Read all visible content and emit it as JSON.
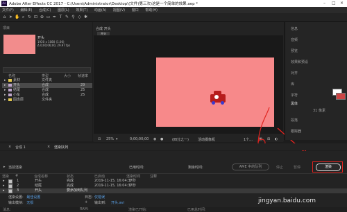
{
  "window": {
    "title": "Adobe After Effects CC 2017 - C:\\Users\\Administrator\\Desktop\\(文件)第三次)这是一个简单的效果.aep *"
  },
  "menu": [
    "文件(F)",
    "编辑(E)",
    "合成(C)",
    "图层(L)",
    "效果(T)",
    "动画(A)",
    "视图(V)",
    "窗口",
    "帮助(H)"
  ],
  "project": {
    "panel_label": "项目",
    "comp_name": "开头",
    "comp_info1": "1920 x 1080 (1.00)",
    "comp_info2": "Δ 0;00;06;00, 29.97 fps",
    "columns": [
      "名称",
      "类型",
      "大小",
      "帧速率"
    ],
    "rows": [
      {
        "name": "素材",
        "type": "文件夹",
        "size": "",
        "fps": "",
        "color": "#e4c94e"
      },
      {
        "name": "开头",
        "type": "合成",
        "size": "",
        "fps": "29",
        "color": "#bfa6cc"
      },
      {
        "name": "结尾",
        "type": "合成",
        "size": "",
        "fps": "25",
        "color": "#bfa6cc"
      },
      {
        "name": "小车",
        "type": "合成",
        "size": "",
        "fps": "25",
        "color": "#bfa6cc"
      },
      {
        "name": "固态层",
        "type": "文件夹",
        "size": "",
        "fps": "",
        "color": "#e4c94e"
      }
    ]
  },
  "viewer": {
    "tab": "合成 开头",
    "subtab": "开头",
    "zoom": "25%",
    "timecode": "0;00;00;00",
    "resolution": "(四分之一)",
    "camera": "活动摄像机",
    "views": "1个..."
  },
  "right_panel": {
    "items": [
      "信息",
      "音频",
      "预览",
      "效果和预设",
      "对齐",
      "库",
      "字符",
      "段落",
      "跟踪器"
    ],
    "font": "黑体",
    "font_size": "31 像素"
  },
  "bottom_tabs": [
    "合成 1",
    "渲染队列"
  ],
  "render_queue": {
    "current_render_label": "当前渲染",
    "elapsed_label": "已用时间:",
    "remaining_label": "剩余时间:",
    "ame_button": "AME 中的队列",
    "stop_button": "停止",
    "pause_button": "暂停",
    "render_button": "渲染",
    "columns": [
      "渲染",
      "#",
      "合成名称",
      "状态",
      "已启动",
      "渲染时间",
      "注释"
    ],
    "rows": [
      {
        "num": "1",
        "name": "开头",
        "status": "完成",
        "started": "2019-11-15, 16:04:37",
        "time": "2 秒"
      },
      {
        "num": "2",
        "name": "结尾",
        "status": "完成",
        "started": "2019-11-15, 16:04:37",
        "time": "1 秒"
      },
      {
        "num": "3",
        "name": "开头",
        "status": "要添加到队列",
        "started": "",
        "time": ""
      }
    ],
    "settings_label": "渲染设置:",
    "settings_value": "最佳设置",
    "log_label": "日志:",
    "log_value": "仅错误",
    "output_module_label": "输出模块:",
    "output_module_value": "无损",
    "output_to_label": "输出到:",
    "output_to_value": "开头.avi",
    "message_label": "消息:",
    "ram_label": "RAM:",
    "started_label": "渲染已开始:",
    "total_label": "已用总时间:"
  },
  "watermark": "jingyan.baidu.com",
  "colors": {
    "comp_bg": "#f7898a",
    "car": "#b61c1c",
    "highlight": "#e0231f"
  }
}
